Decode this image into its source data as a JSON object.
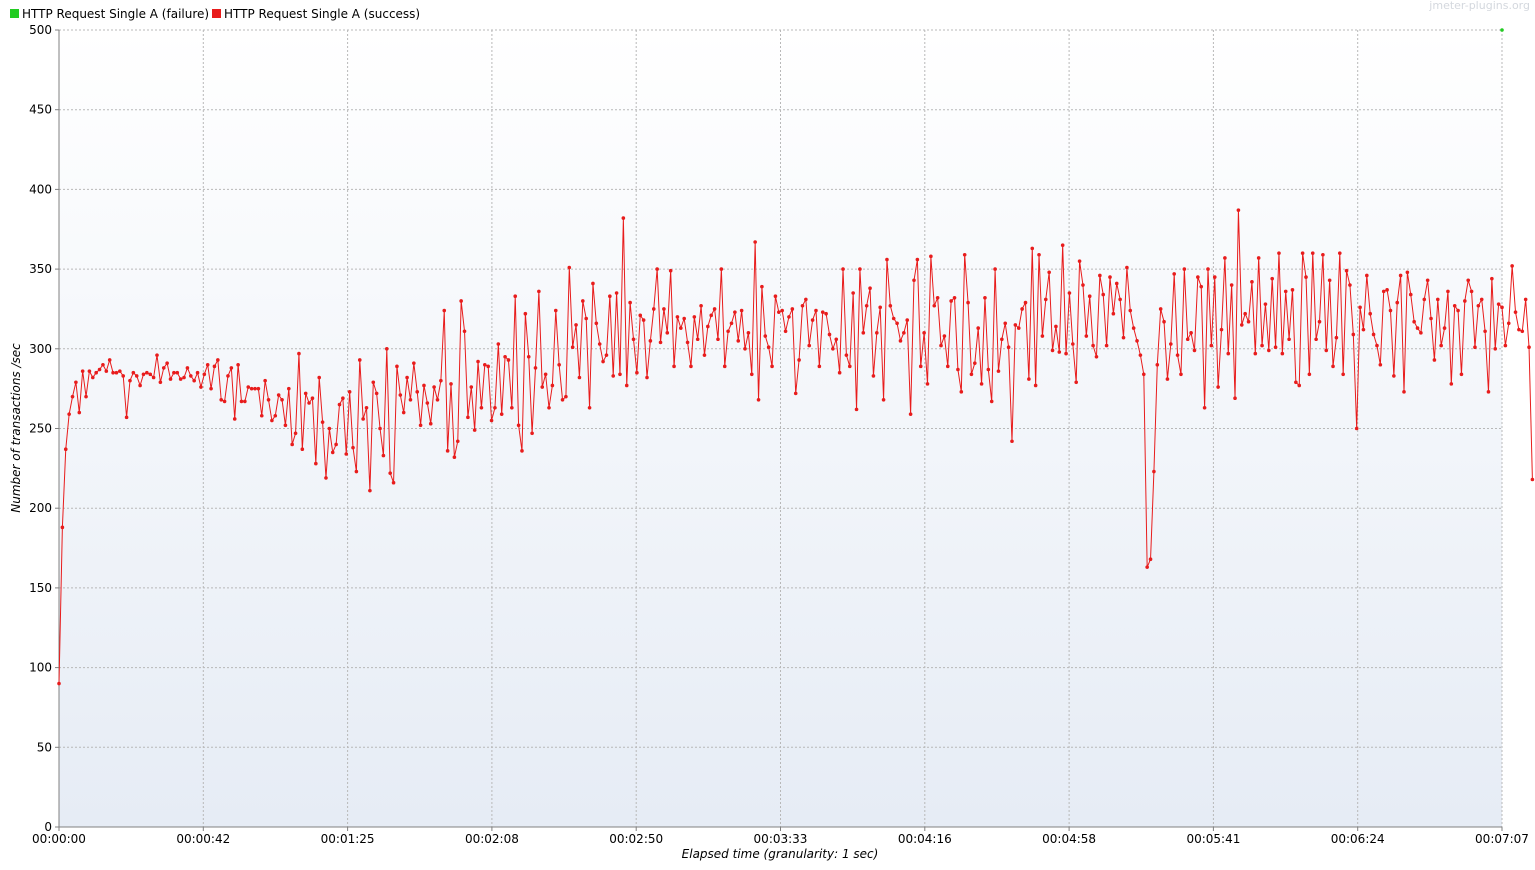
{
  "watermark": "jmeter-plugins.org",
  "chart_data": {
    "type": "line",
    "xlabel": "Elapsed time (granularity: 1 sec)",
    "ylabel": "Number of transactions /sec",
    "xlim": [
      0,
      427
    ],
    "ylim": [
      0,
      500
    ],
    "x_ticks": [
      {
        "value": 0,
        "label": "00:00:00"
      },
      {
        "value": 42.7,
        "label": "00:00:42"
      },
      {
        "value": 85.4,
        "label": "00:01:25"
      },
      {
        "value": 128.1,
        "label": "00:02:08"
      },
      {
        "value": 170.8,
        "label": "00:02:50"
      },
      {
        "value": 213.5,
        "label": "00:03:33"
      },
      {
        "value": 256.2,
        "label": "00:04:16"
      },
      {
        "value": 298.9,
        "label": "00:04:58"
      },
      {
        "value": 341.6,
        "label": "00:05:41"
      },
      {
        "value": 384.3,
        "label": "00:06:24"
      },
      {
        "value": 427,
        "label": "00:07:07"
      }
    ],
    "y_ticks": [
      0,
      50,
      100,
      150,
      200,
      250,
      300,
      350,
      400,
      450,
      500
    ],
    "grid": true,
    "legend_position": "top-left",
    "series": [
      {
        "name": "HTTP Request Single A (failure)",
        "color": "#22cc22",
        "x": [
          427
        ],
        "values": [
          500
        ]
      },
      {
        "name": "HTTP Request Single A (success)",
        "color": "#e81c1c",
        "x_start": 0,
        "x_step": 1,
        "values": [
          90,
          188,
          237,
          259,
          270,
          279,
          260,
          286,
          270,
          286,
          282,
          285,
          287,
          290,
          286,
          293,
          285,
          285,
          286,
          283,
          257,
          280,
          285,
          283,
          277,
          284,
          285,
          284,
          282,
          296,
          279,
          288,
          291,
          281,
          285,
          285,
          281,
          282,
          288,
          283,
          280,
          285,
          276,
          284,
          290,
          275,
          289,
          293,
          268,
          267,
          283,
          288,
          256,
          290,
          267,
          267,
          276,
          275,
          275,
          275,
          258,
          280,
          268,
          255,
          258,
          271,
          268,
          252,
          275,
          240,
          247,
          297,
          237,
          272,
          266,
          269,
          228,
          282,
          254,
          219,
          250,
          235,
          240,
          265,
          269,
          234,
          273,
          238,
          223,
          293,
          256,
          263,
          211,
          279,
          272,
          250,
          233,
          300,
          222,
          216,
          289,
          271,
          260,
          282,
          268,
          291,
          273,
          252,
          277,
          266,
          253,
          276,
          268,
          280,
          324,
          236,
          278,
          232,
          242,
          330,
          311,
          257,
          276,
          249,
          292,
          263,
          290,
          289,
          255,
          263,
          303,
          259,
          295,
          293,
          263,
          333,
          252,
          236,
          322,
          295,
          247,
          288,
          336,
          276,
          284,
          263,
          277,
          324,
          290,
          268,
          270,
          351,
          301,
          315,
          282,
          330,
          319,
          263,
          341,
          316,
          303,
          292,
          296,
          333,
          283,
          335,
          284,
          382,
          277,
          329,
          306,
          285,
          321,
          318,
          282,
          305,
          325,
          350,
          304,
          325,
          310,
          349,
          289,
          320,
          313,
          319,
          304,
          289,
          320,
          306,
          327,
          296,
          314,
          321,
          325,
          306,
          350,
          289,
          311,
          316,
          323,
          305,
          324,
          300,
          310,
          284,
          367,
          268,
          339,
          308,
          301,
          289,
          333,
          323,
          324,
          311,
          320,
          325,
          272,
          293,
          327,
          331,
          302,
          318,
          324,
          289,
          323,
          322,
          309,
          300,
          306,
          285,
          350,
          296,
          289,
          335,
          262,
          350,
          310,
          327,
          338,
          283,
          310,
          326,
          268,
          356,
          327,
          319,
          316,
          305,
          310,
          318,
          259,
          343,
          356,
          289,
          310,
          278,
          358,
          327,
          332,
          302,
          308,
          289,
          330,
          332,
          287,
          273,
          359,
          329,
          284,
          291,
          313,
          278,
          332,
          287,
          267,
          350,
          286,
          306,
          316,
          301,
          242,
          315,
          313,
          325,
          329,
          281,
          363,
          277,
          359,
          308,
          331,
          348,
          299,
          314,
          298,
          365,
          297,
          335,
          303,
          279,
          355,
          340,
          308,
          333,
          302,
          295,
          346,
          334,
          302,
          345,
          322,
          341,
          331,
          307,
          351,
          324,
          313,
          305,
          296,
          284,
          163,
          168,
          223,
          290,
          325,
          317,
          281,
          303,
          347,
          296,
          284,
          350,
          306,
          310,
          299,
          345,
          339,
          263,
          350,
          302,
          345,
          276,
          312,
          357,
          297,
          340,
          269,
          387,
          315,
          322,
          317,
          342,
          297,
          357,
          302,
          328,
          299,
          344,
          301,
          360,
          297,
          336,
          306,
          337,
          279,
          277,
          360,
          345,
          284,
          360,
          306,
          317,
          359,
          299,
          343,
          289,
          307,
          360,
          284,
          349,
          340,
          309,
          250,
          326,
          312,
          346,
          322,
          309,
          302,
          290,
          336,
          337,
          324,
          283,
          329,
          346,
          273,
          348,
          334,
          317,
          313,
          310,
          331,
          343,
          319,
          293,
          331,
          302,
          313,
          336,
          278,
          327,
          324,
          284,
          330,
          343,
          336,
          301,
          327,
          331,
          311,
          273,
          344,
          300,
          328,
          326,
          302,
          316,
          352,
          323,
          312,
          311,
          331,
          301,
          218
        ]
      }
    ]
  }
}
